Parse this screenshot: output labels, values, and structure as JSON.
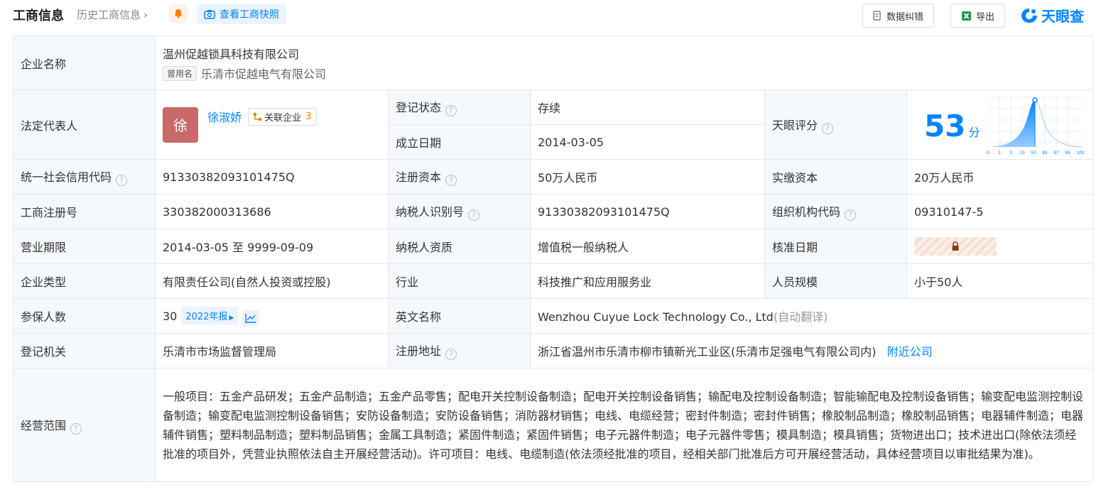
{
  "header": {
    "title": "工商信息",
    "history_label": "历史工商信息",
    "snapshot_label": "查看工商快照",
    "correct_label": "数据纠错",
    "export_label": "导出",
    "logo_text": "天眼查"
  },
  "company": {
    "name_label": "企业名称",
    "name": "温州促越锁具科技有限公司",
    "former_tag": "曾用名",
    "former_name": "乐清市促越电气有限公司",
    "legal_label": "法定代表人",
    "legal_avatar": "徐",
    "legal_name": "徐淑娇",
    "related_label": "关联企业",
    "related_count": "3",
    "status_label": "登记状态",
    "status_value": "存续",
    "established_label": "成立日期",
    "established_value": "2014-03-05",
    "score_label": "天眼评分",
    "score_value": "53",
    "score_unit": "分",
    "score_axis": [
      "0",
      "1",
      "3",
      "15",
      "50",
      "85",
      "97",
      "99",
      "100"
    ],
    "credit_label": "统一社会信用代码",
    "credit_value": "91330382093101475Q",
    "reg_capital_label": "注册资本",
    "reg_capital_value": "50万人民币",
    "paid_capital_label": "实缴资本",
    "paid_capital_value": "20万人民币",
    "reg_no_label": "工商注册号",
    "reg_no_value": "330382000313686",
    "taxpayer_id_label": "纳税人识别号",
    "taxpayer_id_value": "91330382093101475Q",
    "org_code_label": "组织机构代码",
    "org_code_value": "09310147-5",
    "term_label": "营业期限",
    "term_value": "2014-03-05 至 9999-09-09",
    "taxpayer_qual_label": "纳税人资质",
    "taxpayer_qual_value": "增值税一般纳税人",
    "approval_label": "核准日期",
    "type_label": "企业类型",
    "type_value": "有限责任公司(自然人投资或控股)",
    "industry_label": "行业",
    "industry_value": "科技推广和应用服务业",
    "staff_label": "人员规模",
    "staff_value": "小于50人",
    "insured_label": "参保人数",
    "insured_value": "30",
    "insured_year": "2022年报",
    "english_label": "英文名称",
    "english_value": "Wenzhou Cuyue Lock Technology Co., Ltd",
    "english_note": "(自动翻译)",
    "authority_label": "登记机关",
    "authority_value": "乐清市市场监督管理局",
    "address_label": "注册地址",
    "address_value": "浙江省温州市乐清市柳市镇新光工业区(乐清市足强电气有限公司内)",
    "nearby_label": "附近公司",
    "scope_label": "经营范围",
    "scope_value": "一般项目：五金产品研发；五金产品制造；五金产品零售；配电开关控制设备制造；配电开关控制设备销售；输配电及控制设备制造；智能输配电及控制设备销售；输变配电监测控制设备制造；输变配电监测控制设备销售；安防设备制造；安防设备销售；消防器材销售；电线、电缆经营；密封件制造；密封件销售；橡胶制品制造；橡胶制品销售；电器辅件制造；电器辅件销售；塑料制品制造；塑料制品销售；金属工具制造；紧固件制造；紧固件销售；电子元器件制造；电子元器件零售；模具制造；模具销售；货物进出口；技术进出口(除依法须经批准的项目外，凭营业执照依法自主开展经营活动)。许可项目：电线、电缆制造(依法须经批准的项目，经相关部门批准后方可开展经营活动，具体经营项目以审批结果为准)。"
  },
  "colors": {
    "accent": "#0084ff",
    "status_green": "#2aa148",
    "label_bg": "#f5f8fc",
    "border": "#e4e6ea"
  }
}
